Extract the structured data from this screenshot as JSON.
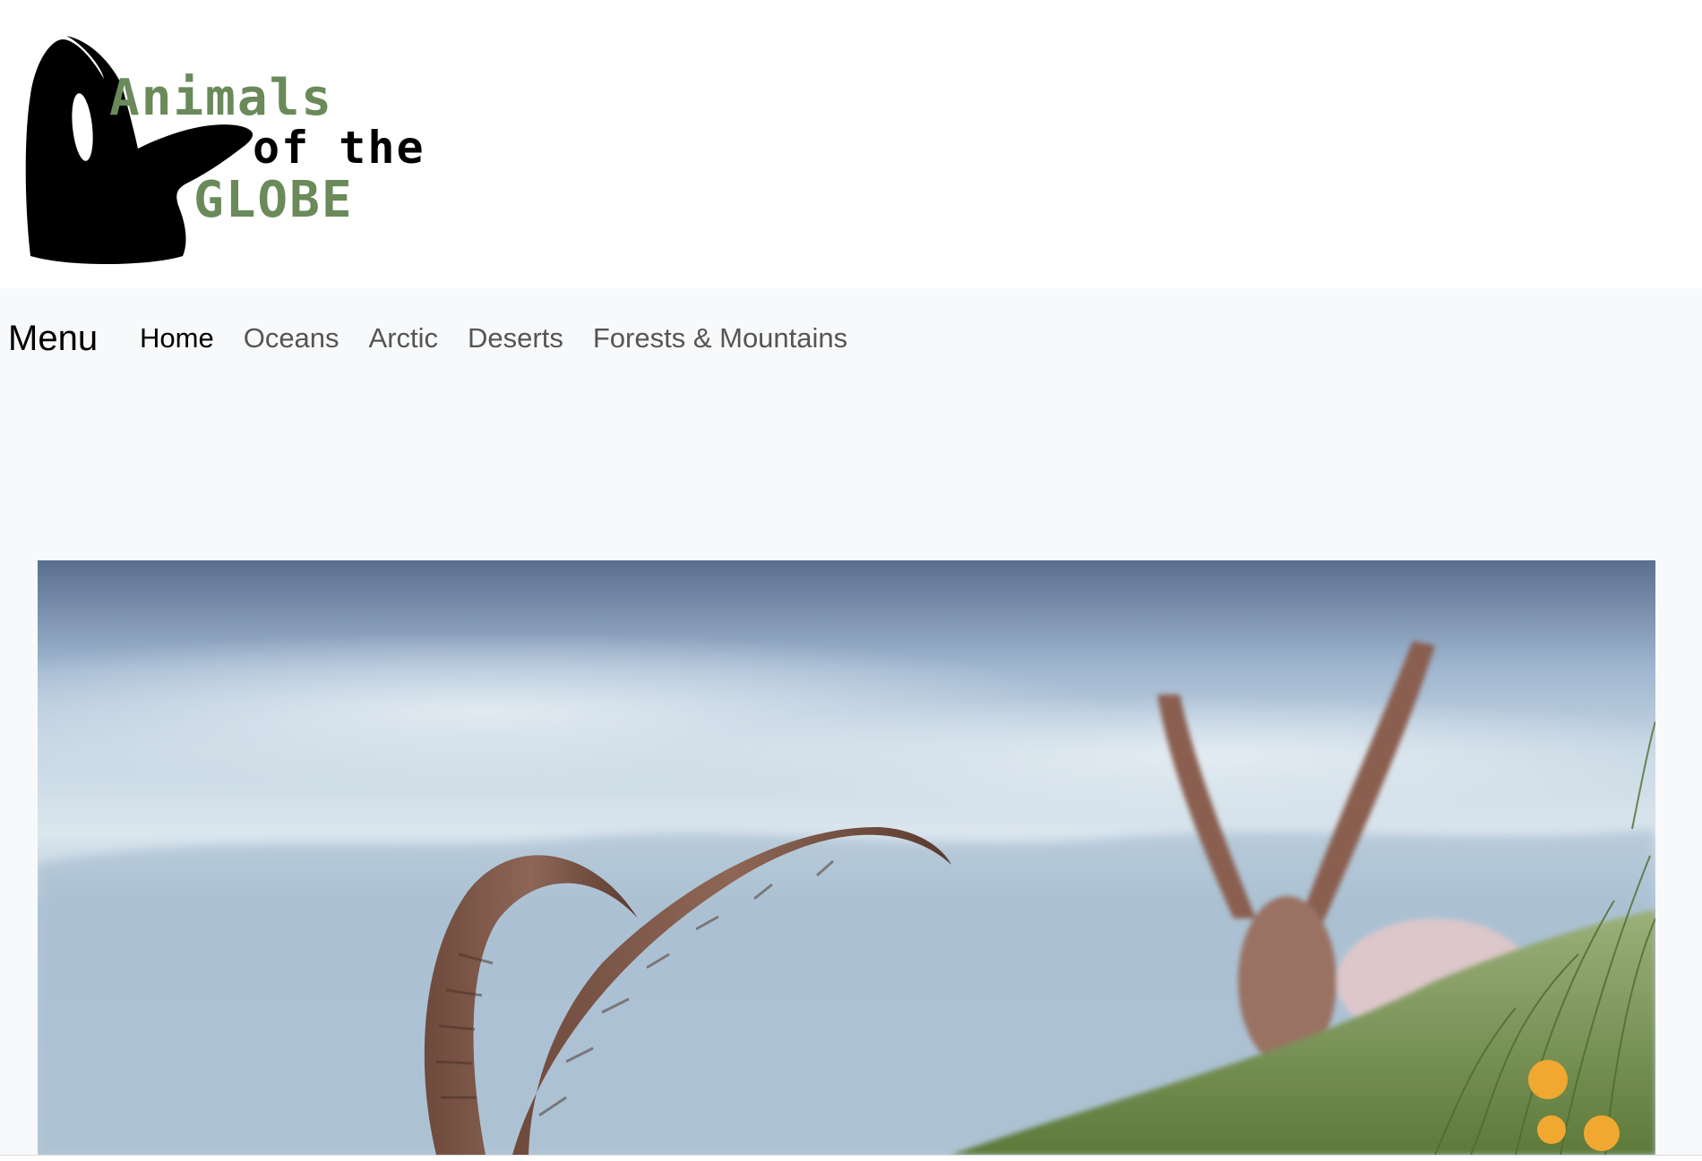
{
  "logo": {
    "line1": "Animals",
    "line2": "of the",
    "line3": "GLOBE",
    "accent_color": "#6a8a5a",
    "icon": "orca-silhouette-icon"
  },
  "nav": {
    "menu_label": "Menu",
    "links": [
      {
        "label": "Home",
        "active": true
      },
      {
        "label": "Oceans",
        "active": false
      },
      {
        "label": "Arctic",
        "active": false
      },
      {
        "label": "Deserts",
        "active": false
      },
      {
        "label": "Forests & Mountains",
        "active": false
      }
    ]
  },
  "hero": {
    "image": "ibex-horns-mountain-photo"
  },
  "colors": {
    "nav_background": "#f8f9fa",
    "nav_link": "#555555",
    "nav_link_active": "#000000"
  }
}
